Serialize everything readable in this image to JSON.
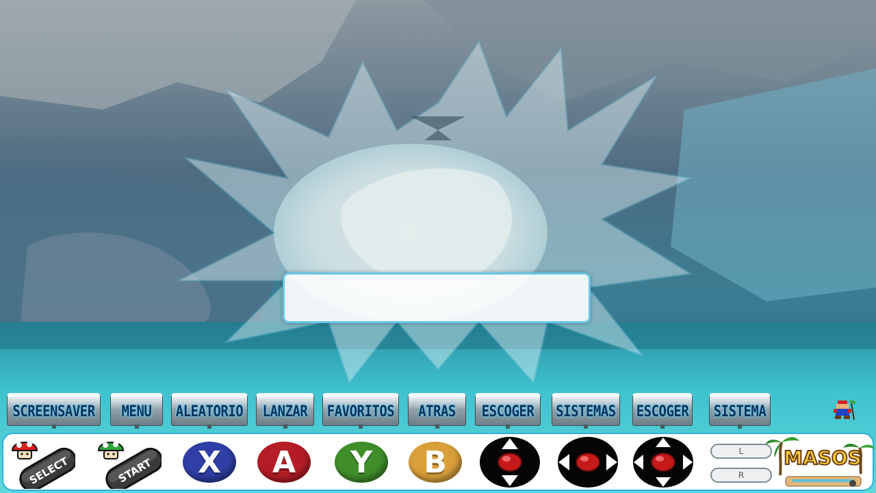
{
  "action_labels": [
    {
      "text": "SCREENSAVER"
    },
    {
      "text": "MENU"
    },
    {
      "text": "ALEATORIO"
    },
    {
      "text": "LANZAR"
    },
    {
      "text": "FAVORITOS"
    },
    {
      "text": "ATRAS"
    },
    {
      "text": "ESCOGER"
    },
    {
      "text": "SISTEMAS"
    },
    {
      "text": "ESCOGER"
    },
    {
      "text": "SISTEMA"
    }
  ],
  "controls": {
    "select_label": "SELECT",
    "start_label": "START",
    "x_label": "X",
    "a_label": "A",
    "y_label": "Y",
    "b_label": "B",
    "l_label": "L",
    "r_label": "R"
  },
  "logo_text": "MASOS",
  "colors": {
    "x_button": "#2f3fa6",
    "a_button": "#b51d26",
    "y_button": "#3f8e2a",
    "b_button": "#d9a03a",
    "label_text": "#0c2f55",
    "label_glow": "#6ad4ff",
    "bar_border": "#2fb2d8"
  },
  "icons": [
    "mushroom-red-icon",
    "mushroom-green-icon",
    "dpad-up-down-icon",
    "dpad-left-right-icon",
    "dpad-all-directions-icon",
    "mario-sprite-icon",
    "palm-tree-icon"
  ]
}
